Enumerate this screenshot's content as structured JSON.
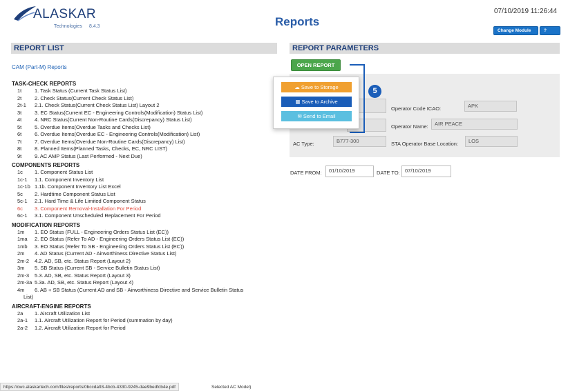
{
  "header": {
    "logo_text": "ALASKAR",
    "logo_sub": "Technologies",
    "logo_version": "8.4.3",
    "page_title": "Reports",
    "datetime": "07/10/2019 11:26:44",
    "change_module": "Change Module",
    "help": "Help"
  },
  "report_list": {
    "title": "REPORT LIST",
    "category": "CAM (Part-M) Reports",
    "groups": [
      {
        "title": "TASK-CHECK REPORTS",
        "items": [
          {
            "code": "1t",
            "label": "1. Task Status (Current Task Status List)"
          },
          {
            "code": "2t",
            "label": "2. Check Status(Current Check Status List)"
          },
          {
            "code": "2t-1",
            "label": "2.1. Check Status(Current Check Status List) Layout 2"
          },
          {
            "code": "3t",
            "label": "3. EC Status(Current EC - Engineering Controls(Modification) Status List)"
          },
          {
            "code": "4t",
            "label": "4. NRC Status(Current Non-Routine Cards(Discrepancy) Status List)"
          },
          {
            "code": "5t",
            "label": "5. Overdue Items(Overdue Tasks and Checks List)"
          },
          {
            "code": "6t",
            "label": "6. Overdue Items(Overdue EC - Engineering Controls(Modification) List)"
          },
          {
            "code": "7t",
            "label": "7. Overdue Items(Overdue Non-Routine Cards(Discrepancy) List)"
          },
          {
            "code": "8t",
            "label": "8. Planned Items(Planned Tasks, Checks, EC, NRC LIST)"
          },
          {
            "code": "9t",
            "label": "9. AC AMP Status (Last Performed - Next Due)"
          }
        ]
      },
      {
        "title": "COMPONENTS REPORTS",
        "items": [
          {
            "code": "1c",
            "label": "1. Component Status List"
          },
          {
            "code": "1c-1",
            "label": "1.1. Component Inventory List"
          },
          {
            "code": "1c-1b",
            "label": "1.1b. Component Inventory List Excel"
          },
          {
            "code": "5c",
            "label": "2. Hardtime Component Status List"
          },
          {
            "code": "5c-1",
            "label": "2.1. Hard Time & Life Limited Component Status"
          },
          {
            "code": "6c",
            "label": "3. Component Removal-Installation For Period"
          },
          {
            "code": "6c-1",
            "label": "3.1. Component Unscheduled Replacement For Period"
          }
        ]
      },
      {
        "title": "MODIFICATION REPORTS",
        "items": [
          {
            "code": "1m",
            "label": "1. EO Status (FULL - Engineering Orders Status List (EC))"
          },
          {
            "code": "1ma",
            "label": "2. EO Status (Refer To AD - Engineering Orders Status List (EC))"
          },
          {
            "code": "1mb",
            "label": "3. EO Status (Refer To SB - Engineering Orders Status List (EC))"
          },
          {
            "code": "2m",
            "label": "4. AD Status (Current AD - Airworthiness Directive Status List)"
          },
          {
            "code": "2m-2",
            "label": "4.2. AD, SB, etc. Status Report (Layout 2)"
          },
          {
            "code": "3m",
            "label": "5. SB Status (Current SB - Service Bulletin Status List)"
          },
          {
            "code": "2m-3",
            "label": "5.3. AD, SB, etc. Status Report (Layout 3)"
          },
          {
            "code": "2m-3a",
            "label": "5.3a. AD, SB, etc. Status Report (Layout 4)"
          },
          {
            "code": "4m",
            "label": "6. AB + SB Status (Current AD and SB - Airworthiness Directive and Service Bulletin Status",
            "cont": "List)"
          }
        ]
      },
      {
        "title": "AIRCRAFT-ENGINE REPORTS",
        "items": [
          {
            "code": "2a",
            "label": "1. Aircraft Utilization List"
          },
          {
            "code": "2a-1",
            "label": "1.1. Aircraft Utilization Report for Period (summation by day)"
          },
          {
            "code": "2a-2",
            "label": "1.2. Aircraft Utilization Report for Period"
          }
        ]
      }
    ]
  },
  "report_parameters": {
    "title": "REPORT PARAMETERS",
    "open_report": "OPEN REPORT",
    "operator_icao_label": "Operator Code ICAO:",
    "operator_icao_value": "APK",
    "operator_name_label": "Operator Name:",
    "operator_name_value": "AIR PEACE",
    "ac_type_label": "AC Type:",
    "ac_type_value": "B777-300",
    "sta_base_label": "STA Operator Base Location:",
    "sta_base_value": "LOS",
    "date_from_label": "DATE FROM:",
    "date_from_value": "01/10/2019",
    "date_to_label": "DATE TO:",
    "date_to_value": "07/10/2019"
  },
  "dropdown": {
    "save_storage": "Save to Storage",
    "save_archive": "Save to Archive",
    "send_email": "Send to Email"
  },
  "step_badge": "5",
  "status_bar": {
    "url": "https://cwc.alaskartech.com/files/reports/0bccda93-4bcb-4330-9245-dae9bedfcb4e.pdf",
    "tail": "Selected AC Model)"
  },
  "colors": {
    "accent_blue": "#1a5db8",
    "open_green": "#4ba64b",
    "storage_orange": "#f0a030",
    "email_cyan": "#5bbfe0",
    "highlight_red": "#e0483b"
  }
}
